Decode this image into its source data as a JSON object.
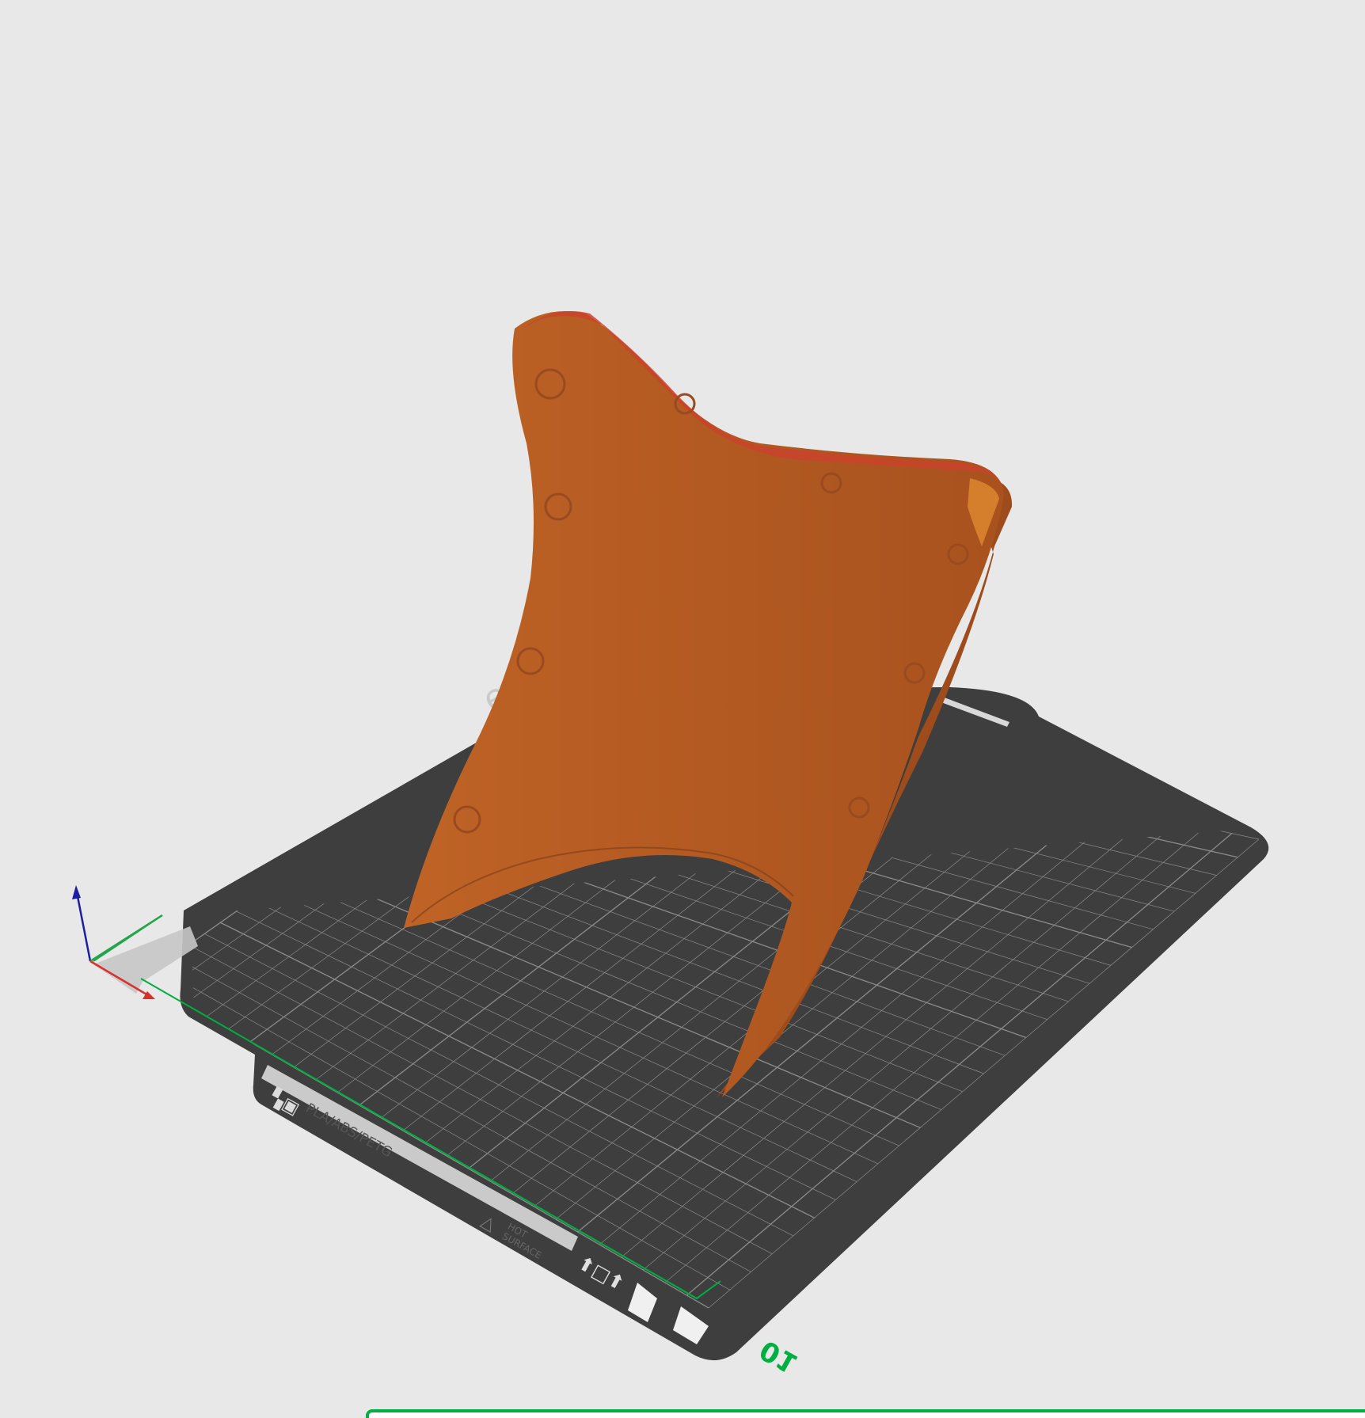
{
  "viewport": {
    "background_color": "#e8e8e8",
    "plate": {
      "brand_text": "ed PEI Plate",
      "material_label": "PLA/ABS/PETG",
      "warning_label_line1": "HOT",
      "warning_label_line2": "SURFACE",
      "plate_number": "01",
      "plate_color": "#3d3e3d",
      "grid_color": "#8a8b8a",
      "label_strip_color": "#c9cac9"
    },
    "axes": {
      "x_color": "#d9312a",
      "y_color": "#22a54a",
      "z_color": "#1d1ea0"
    },
    "model": {
      "color": "#b35a22",
      "edge_highlight_color": "#d33a2a",
      "overhang_color": "#e08a30"
    },
    "accent_color": "#00ae42"
  }
}
